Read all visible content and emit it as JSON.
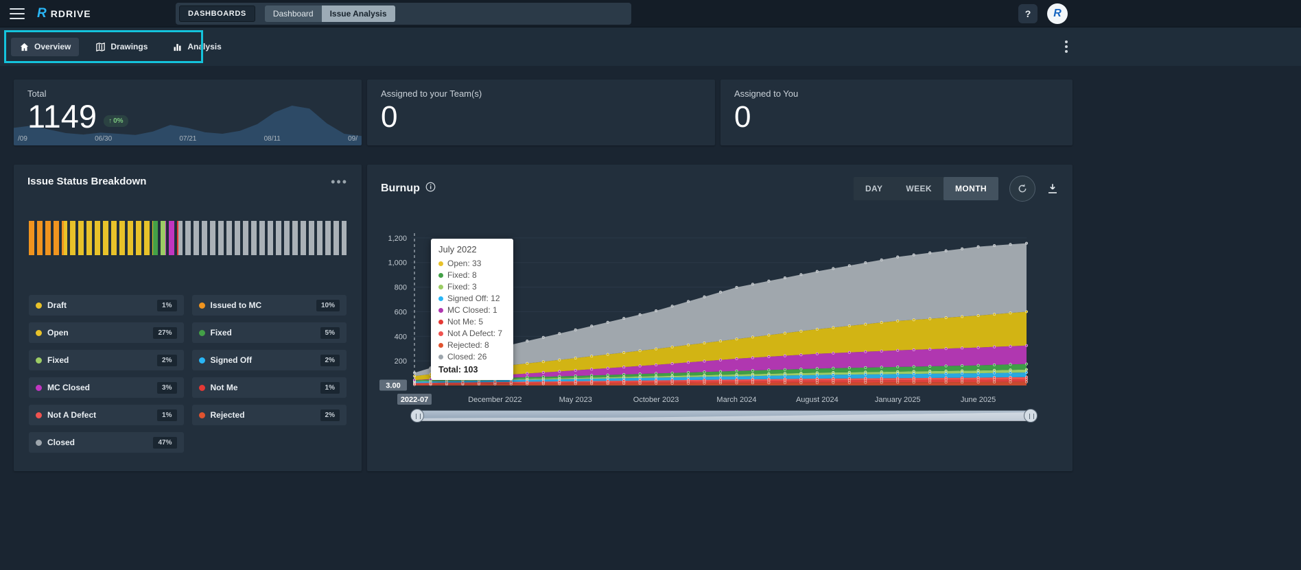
{
  "topbar": {
    "brand": "RDRIVE",
    "brand_mark": "R",
    "section_label": "DASHBOARDS",
    "tabs": [
      {
        "label": "Dashboard"
      },
      {
        "label": "Issue Analysis"
      }
    ],
    "help_label": "?"
  },
  "nav": {
    "items": [
      {
        "label": "Overview"
      },
      {
        "label": "Drawings"
      },
      {
        "label": "Analysis"
      }
    ]
  },
  "kpis": {
    "total": {
      "title": "Total",
      "value": "1149",
      "delta_arrow": "↑",
      "delta": "0%",
      "x_labels": [
        "/09",
        "06/30",
        "07/21",
        "08/11",
        "09/"
      ],
      "spark_values": [
        40,
        46,
        36,
        26,
        22,
        27,
        24,
        21,
        30,
        48,
        40,
        28,
        24,
        32,
        50,
        82,
        100,
        92,
        52,
        24,
        18
      ],
      "spark_color": "#2d4a66"
    },
    "team": {
      "title": "Assigned to your Team(s)",
      "value": "0"
    },
    "you": {
      "title": "Assigned to You",
      "value": "0"
    }
  },
  "issue_status": {
    "title": "Issue Status Breakdown",
    "bar_segments": [
      {
        "name": "Issued to MC",
        "pct": 11,
        "color": "#f0941f"
      },
      {
        "name": "Open",
        "pct": 28,
        "color": "#e8c22a"
      },
      {
        "name": "Fixed",
        "pct": 2,
        "color": "#43a047"
      },
      {
        "name": "Fixed",
        "pct": 2,
        "color": "#9ccc65"
      },
      {
        "name": "MC Closed",
        "pct": 3,
        "color": "#c136c1"
      },
      {
        "name": "Not A Defect",
        "pct": 1,
        "color": "#e53935"
      },
      {
        "name": "Closed",
        "pct": 53,
        "color": "#aab1b7"
      }
    ],
    "legend": [
      {
        "label": "Draft",
        "pct": "1%",
        "color": "#e8c22a"
      },
      {
        "label": "Issued to MC",
        "pct": "10%",
        "color": "#f0941f"
      },
      {
        "label": "Open",
        "pct": "27%",
        "color": "#e8c22a"
      },
      {
        "label": "Fixed",
        "pct": "5%",
        "color": "#43a047"
      },
      {
        "label": "Fixed",
        "pct": "2%",
        "color": "#9ccc65"
      },
      {
        "label": "Signed Off",
        "pct": "2%",
        "color": "#29b6f6"
      },
      {
        "label": "MC Closed",
        "pct": "3%",
        "color": "#c136c1"
      },
      {
        "label": "Not Me",
        "pct": "1%",
        "color": "#e53935"
      },
      {
        "label": "Not A Defect",
        "pct": "1%",
        "color": "#ef5350"
      },
      {
        "label": "Rejected",
        "pct": "2%",
        "color": "#e0532f"
      },
      {
        "label": "Closed",
        "pct": "47%",
        "color": "#9ea6ad"
      }
    ]
  },
  "burnup": {
    "title": "Burnup",
    "range_buttons": [
      "DAY",
      "WEEK",
      "MONTH"
    ],
    "active_range": "MONTH",
    "y_ticks": [
      "1,200",
      "1,000",
      "800",
      "600",
      "400",
      "200"
    ],
    "y_cursor": "3.00",
    "x_labels": [
      {
        "label": "2022-07",
        "month": 0,
        "badge": true
      },
      {
        "label": "December 2022",
        "month": 5
      },
      {
        "label": "May 2023",
        "month": 10
      },
      {
        "label": "October 2023",
        "month": 15
      },
      {
        "label": "March 2024",
        "month": 20
      },
      {
        "label": "August 2024",
        "month": 25
      },
      {
        "label": "January 2025",
        "month": 30
      },
      {
        "label": "June 2025",
        "month": 35
      }
    ],
    "tooltip": {
      "title": "July 2022",
      "rows": [
        {
          "label": "Open",
          "value": 33,
          "color": "#e8c22a"
        },
        {
          "label": "Fixed",
          "value": 8,
          "color": "#43a047"
        },
        {
          "label": "Fixed",
          "value": 3,
          "color": "#9ccc65"
        },
        {
          "label": "Signed Off",
          "value": 12,
          "color": "#29b6f6"
        },
        {
          "label": "MC Closed",
          "value": 1,
          "color": "#b037b0"
        },
        {
          "label": "Not Me",
          "value": 5,
          "color": "#e53935"
        },
        {
          "label": "Not A Defect",
          "value": 7,
          "color": "#ef5350"
        },
        {
          "label": "Rejected",
          "value": 8,
          "color": "#e0532f"
        },
        {
          "label": "Closed",
          "value": 26,
          "color": "#9ea6ad"
        }
      ],
      "total_label": "Total:",
      "total": "103"
    },
    "chart_data": {
      "type": "area",
      "stacked": true,
      "x_unit": "month",
      "sample_months": [
        0,
        5,
        10,
        15,
        20,
        25,
        30,
        35,
        38
      ],
      "sample_labels": [
        "2022-07",
        "2022-12",
        "2023-05",
        "2023-10",
        "2024-03",
        "2024-08",
        "2025-01",
        "2025-06",
        "2025-09"
      ],
      "ylim": [
        0,
        1216
      ],
      "series": [
        {
          "name": "Rejected",
          "color": "#c84a2e",
          "values": [
            8,
            12,
            15,
            18,
            21,
            24,
            26,
            28,
            30
          ]
        },
        {
          "name": "Not A Defect",
          "color": "#e0403c",
          "values": [
            7,
            9,
            11,
            13,
            15,
            17,
            18,
            19,
            20
          ]
        },
        {
          "name": "Not Me",
          "color": "#ef5350",
          "values": [
            5,
            7,
            9,
            11,
            13,
            15,
            16,
            17,
            18
          ]
        },
        {
          "name": "Signed Off",
          "color": "#2aa8e0",
          "values": [
            12,
            15,
            18,
            22,
            26,
            30,
            33,
            36,
            38
          ]
        },
        {
          "name": "Fixed",
          "color": "#9ccc65",
          "values": [
            3,
            6,
            9,
            12,
            15,
            18,
            20,
            22,
            24
          ]
        },
        {
          "name": "Fixed",
          "color": "#3f9d46",
          "values": [
            8,
            12,
            16,
            22,
            28,
            34,
            38,
            42,
            45
          ]
        },
        {
          "name": "MC Closed",
          "color": "#b037b0",
          "values": [
            1,
            20,
            45,
            70,
            100,
            120,
            135,
            145,
            150
          ]
        },
        {
          "name": "Open",
          "color": "#d2b414",
          "values": [
            33,
            70,
            100,
            130,
            160,
            200,
            240,
            260,
            275
          ]
        },
        {
          "name": "Closed",
          "color": "#a0a7ad",
          "values": [
            26,
            150,
            230,
            310,
            420,
            470,
            520,
            560,
            557
          ]
        }
      ]
    }
  }
}
